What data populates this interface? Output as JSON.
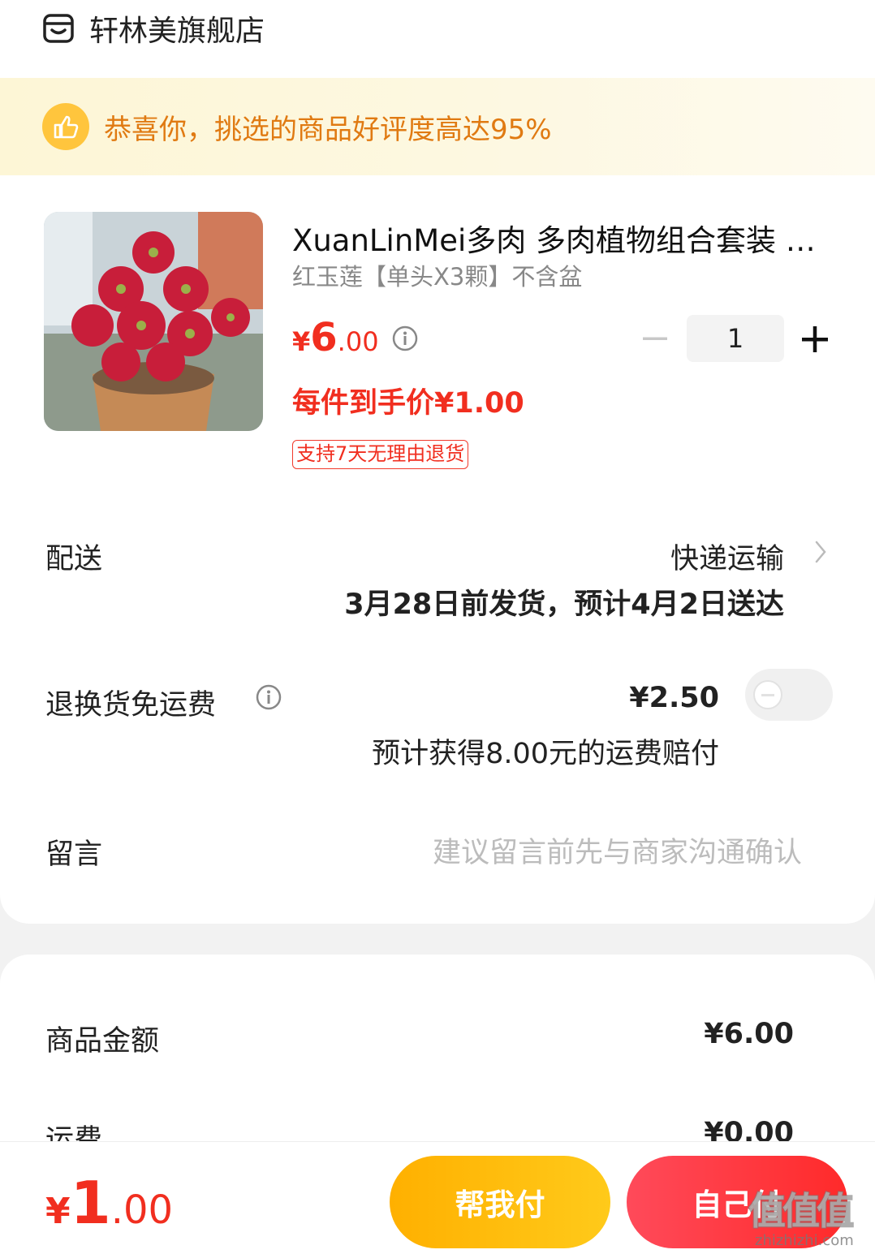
{
  "store": {
    "name": "轩林美旗舰店",
    "icon": "store-icon"
  },
  "banner": {
    "text": "恭喜你，挑选的商品好评度高达95%",
    "icon": "thumbs-up-icon"
  },
  "product": {
    "title": "XuanLinMei多肉 多肉植物组合套装 多肉盆栽",
    "spec": "红玉莲【单头X3颗】不含盆",
    "price_currency": "¥",
    "price_int": "6",
    "price_dec": ".00",
    "each_price": "每件到手价¥1.00",
    "return_tag": "支持7天无理由退货",
    "quantity": "1"
  },
  "delivery": {
    "label": "配送",
    "method": "快递运输",
    "eta": "3月28日前发货，预计4月2日送达"
  },
  "freight_insurance": {
    "label": "退换货免运费",
    "price": "¥2.50",
    "note": "预计获得8.00元的运费赔付",
    "enabled": false
  },
  "message": {
    "label": "留言",
    "placeholder": "建议留言前先与商家沟通确认"
  },
  "summary": {
    "goods_label": "商品金额",
    "goods_value": "¥6.00",
    "shipping_label": "运费",
    "shipping_value": "¥0.00"
  },
  "footer": {
    "total_currency": "¥",
    "total_int": "1",
    "total_dec": ".00",
    "help_pay": "帮我付",
    "self_pay": "自己付"
  },
  "watermark": {
    "text": "值值值",
    "url": "zhizhizhi.com"
  },
  "colors": {
    "accent_red": "#f12e1f",
    "banner_text": "#e07a12",
    "help_btn": "#ffb000",
    "self_btn": "#ff3a3a"
  }
}
